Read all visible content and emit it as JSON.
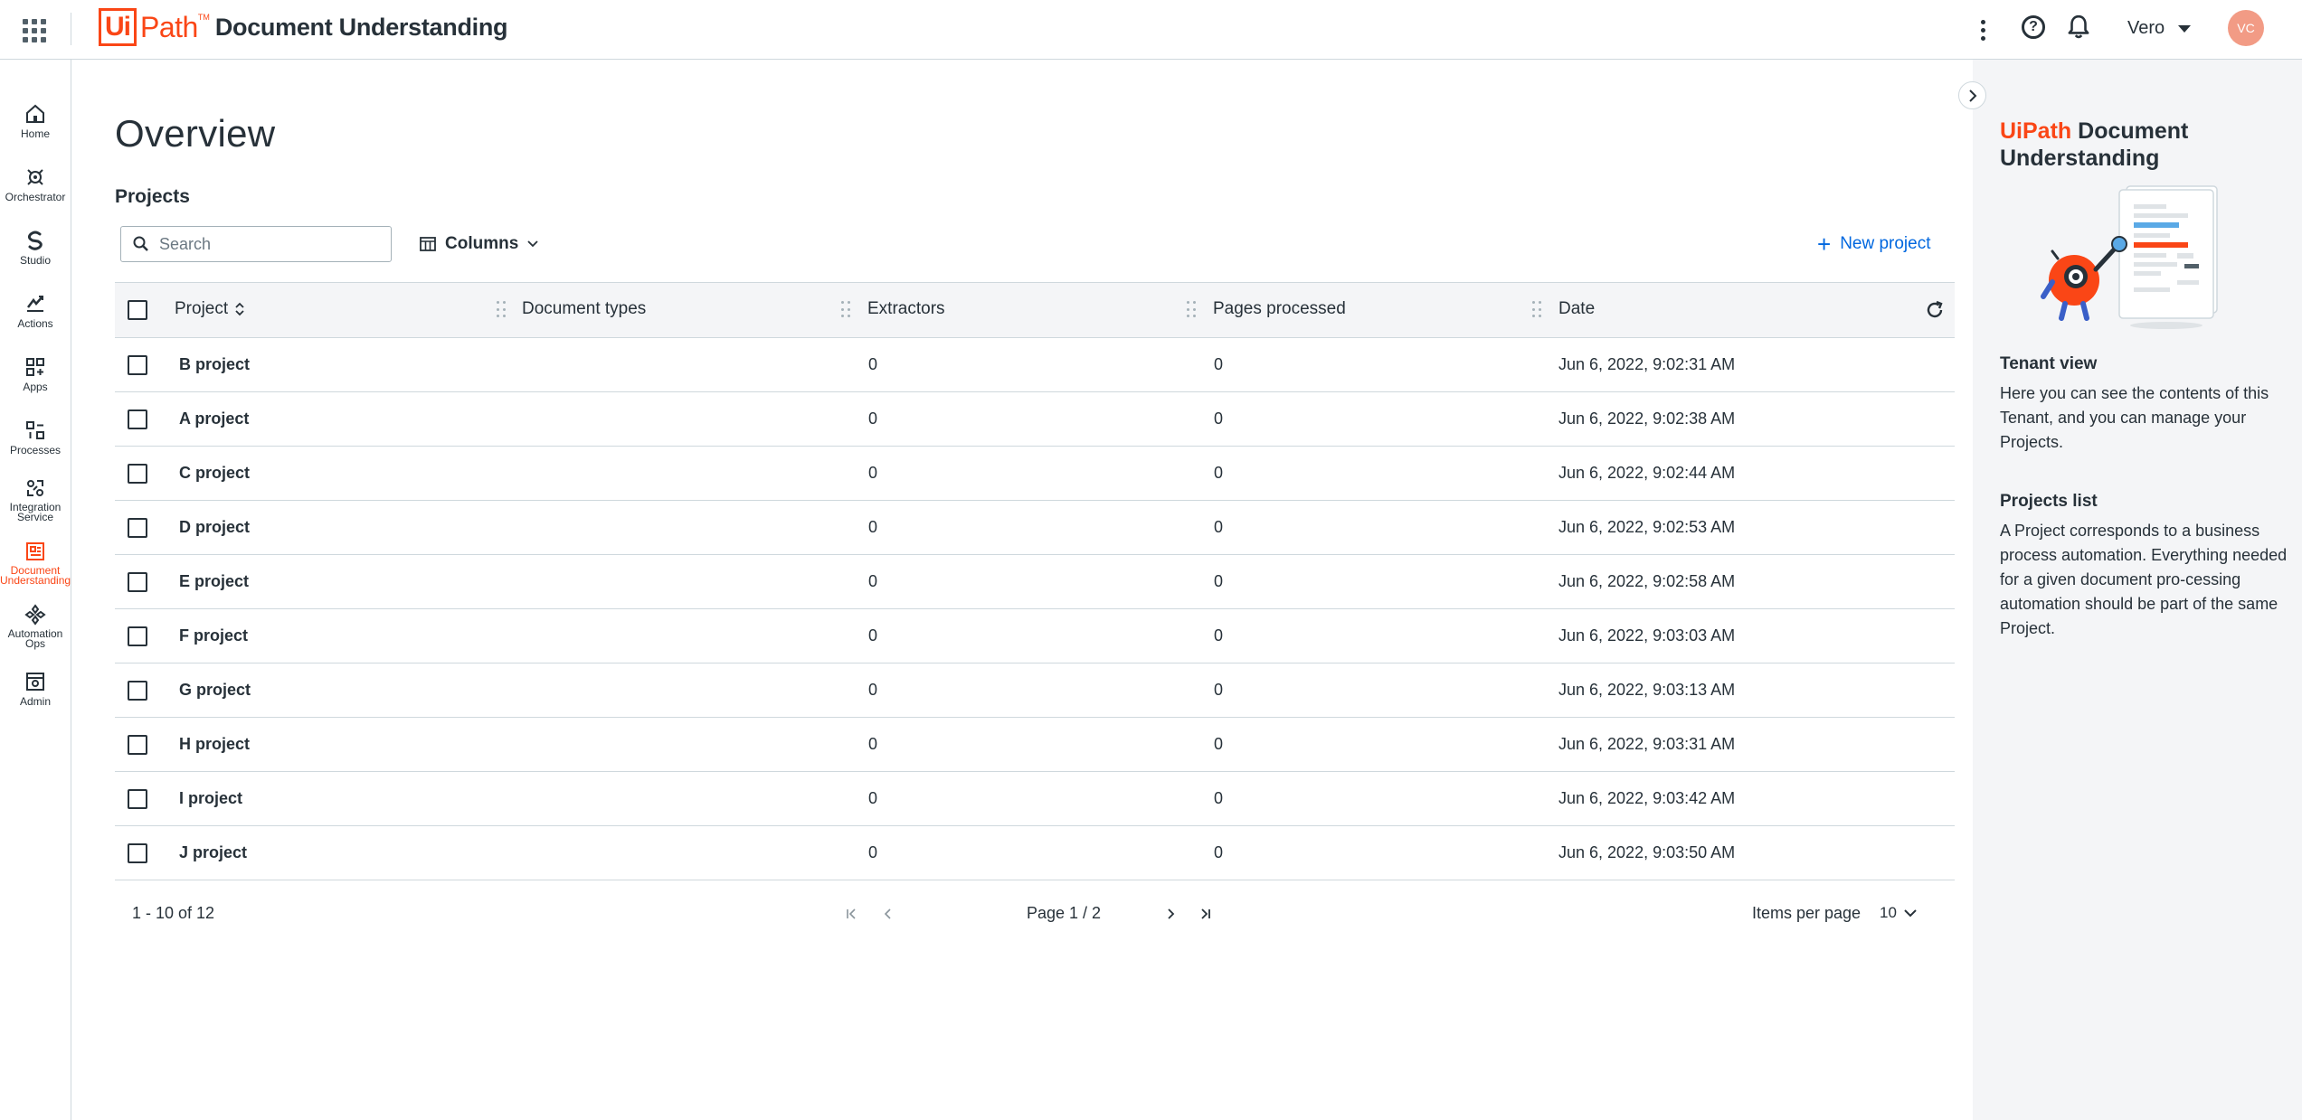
{
  "header": {
    "logo_ui": "Ui",
    "logo_path": "Path",
    "logo_tm": "TM",
    "product": "Document Understanding",
    "user": "Vero",
    "avatar_initials": "VC"
  },
  "nav": [
    {
      "label": "Home",
      "icon": "home-icon"
    },
    {
      "label": "Orchestrator",
      "icon": "orchestrator-icon"
    },
    {
      "label": "Studio",
      "icon": "studio-icon"
    },
    {
      "label": "Actions",
      "icon": "actions-icon"
    },
    {
      "label": "Apps",
      "icon": "apps-icon"
    },
    {
      "label": "Processes",
      "icon": "processes-icon"
    },
    {
      "label": "Integration Service",
      "icon": "integration-icon"
    },
    {
      "label": "Document Understanding",
      "icon": "document-understanding-icon",
      "active": true
    },
    {
      "label": "Automation Ops",
      "icon": "automation-ops-icon"
    },
    {
      "label": "Admin",
      "icon": "admin-icon"
    }
  ],
  "main": {
    "title": "Overview",
    "section": "Projects",
    "search_placeholder": "Search",
    "columns_label": "Columns",
    "new_project_label": "New project",
    "table": {
      "headers": [
        "Project",
        "Document types",
        "Extractors",
        "Pages processed",
        "Date"
      ],
      "rows": [
        {
          "project": "B project",
          "document_types": "",
          "extractors": "0",
          "pages": "0",
          "date": "Jun 6, 2022, 9:02:31 AM"
        },
        {
          "project": "A project",
          "document_types": "",
          "extractors": "0",
          "pages": "0",
          "date": "Jun 6, 2022, 9:02:38 AM"
        },
        {
          "project": "C project",
          "document_types": "",
          "extractors": "0",
          "pages": "0",
          "date": "Jun 6, 2022, 9:02:44 AM"
        },
        {
          "project": "D project",
          "document_types": "",
          "extractors": "0",
          "pages": "0",
          "date": "Jun 6, 2022, 9:02:53 AM"
        },
        {
          "project": "E project",
          "document_types": "",
          "extractors": "0",
          "pages": "0",
          "date": "Jun 6, 2022, 9:02:58 AM"
        },
        {
          "project": "F project",
          "document_types": "",
          "extractors": "0",
          "pages": "0",
          "date": "Jun 6, 2022, 9:03:03 AM"
        },
        {
          "project": "G project",
          "document_types": "",
          "extractors": "0",
          "pages": "0",
          "date": "Jun 6, 2022, 9:03:13 AM"
        },
        {
          "project": "H project",
          "document_types": "",
          "extractors": "0",
          "pages": "0",
          "date": "Jun 6, 2022, 9:03:31 AM"
        },
        {
          "project": "I project",
          "document_types": "",
          "extractors": "0",
          "pages": "0",
          "date": "Jun 6, 2022, 9:03:42 AM"
        },
        {
          "project": "J project",
          "document_types": "",
          "extractors": "0",
          "pages": "0",
          "date": "Jun 6, 2022, 9:03:50 AM"
        }
      ]
    },
    "footer": {
      "range": "1 - 10 of 12",
      "page": "Page 1 / 2",
      "items_per_page_label": "Items per page",
      "items_per_page_value": "10"
    }
  },
  "panel": {
    "title_brand": "UiPath",
    "title_rest": " Document Understanding",
    "h1": "Tenant view",
    "p1": "Here you can see the contents of this Tenant, and you can manage your Projects.",
    "h2": "Projects list",
    "p2": "A Project corresponds to a business process automation. Everything needed for a given document pro-cessing automation should be part of the same Project."
  },
  "colors": {
    "brand": "#fa4616",
    "link": "#0067df",
    "text": "#273139",
    "header_bg": "#f4f5f7",
    "panel_bg": "#f4f5f7",
    "avatar": "#f29b85"
  }
}
